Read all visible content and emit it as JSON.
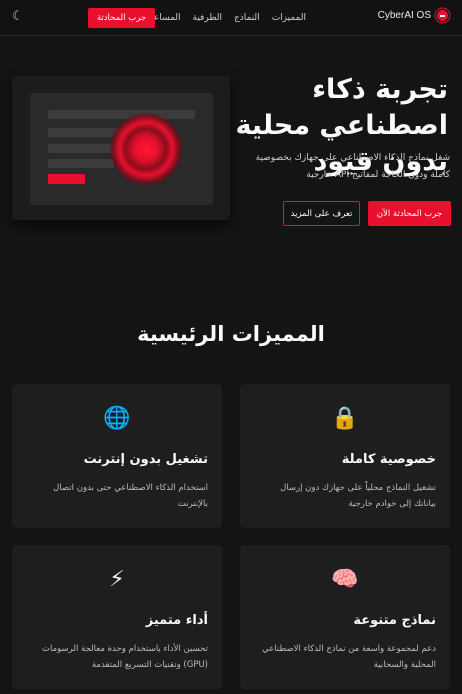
{
  "nav": {
    "brand": "CyberAI OS",
    "links": [
      "المميزات",
      "النماذج",
      "الطرفية",
      "المساعدة"
    ],
    "cta": "جرب المحادثة",
    "theme_icon": "moon-icon"
  },
  "hero": {
    "title": "تجربة ذكاء اصطناعي محلية بدون قيود",
    "description": "شغل نماذج الذكاء الاصطناعي على جهازك بخصوصية كاملة ودون الحاجة لمفاتيح API خارجية",
    "primary_button": "جرب المحادثة الآن",
    "secondary_button": "تعرف على المزيد"
  },
  "features": {
    "title": "المميزات الرئيسية",
    "cards": [
      {
        "icon": "🔒",
        "icon_name": "lock-icon",
        "title": "خصوصية كاملة",
        "desc": "تشغيل النماذج محلياً على جهازك دون إرسال بياناتك إلى خوادم خارجية"
      },
      {
        "icon": "🌐",
        "icon_name": "globe-icon",
        "title": "تشغيل بدون إنترنت",
        "desc": "استخدام الذكاء الاصطناعي حتى بدون اتصال بالإنترنت"
      },
      {
        "icon": "🧠",
        "icon_name": "brain-icon",
        "title": "نماذج متنوعة",
        "desc": "دعم لمجموعة واسعة من نماذج الذكاء الاصطناعي المحلية والسحابية"
      },
      {
        "icon": "⚡",
        "icon_name": "lightning-icon",
        "title": "أداء متميز",
        "desc": "تحسين الأداء باستخدام وحدة معالجة الرسومات (GPU) وتقنيات التسريع المتقدمة"
      }
    ]
  },
  "colors": {
    "accent": "#e8102d",
    "background": "#141414",
    "card": "#1e1e1e"
  }
}
